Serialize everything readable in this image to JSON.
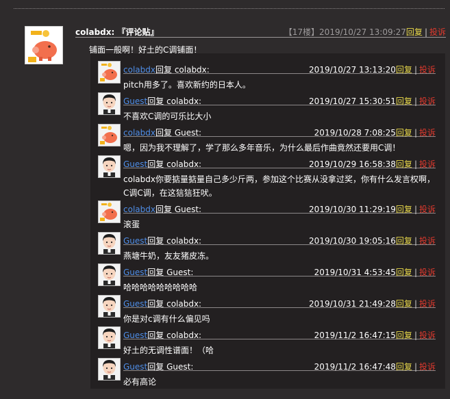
{
  "main": {
    "author": "colabdx:",
    "tag": "『评论贴』",
    "floor": "【17楼】",
    "time": "2019/10/27 13:09:27",
    "reply_label": "回复",
    "report_label": "投诉",
    "sep": "|",
    "text": "铺面一般啊！好土的C调铺面！"
  },
  "colors": {
    "background": "#2e2b2c",
    "replies_bg": "#232021",
    "user_link": "#4f8ee8",
    "reply": "#e8d94a",
    "report": "#e23a2e"
  },
  "replies": [
    {
      "user": "colabdx",
      "avatar": "piggy-bank",
      "reply_word": "回复",
      "target": "colabdx:",
      "time": "2019/10/27 13:13:20",
      "text": "pitch用多了。喜欢新约的日本人。"
    },
    {
      "user": "Guest",
      "avatar": "boy",
      "reply_word": "回复",
      "target": "colabdx:",
      "time": "2019/10/27 15:30:51",
      "text": "不喜欢C调的可乐比大小"
    },
    {
      "user": "colabdx",
      "avatar": "piggy-bank",
      "reply_word": "回复",
      "target": "Guest:",
      "time": "2019/10/28 7:08:25",
      "text": "嗯，因为我不理解了，学了那么多年音乐，为什么最后作曲竟然还要用C调！"
    },
    {
      "user": "Guest",
      "avatar": "boy",
      "reply_word": "回复",
      "target": "colabdx:",
      "time": "2019/10/29 16:58:38",
      "text": "colabdx你要掂量掂量自己多少斤两，参加这个比赛从没拿过奖，你有什么发言权啊，C调C调，在这狺狺狂吠。"
    },
    {
      "user": "colabdx",
      "avatar": "piggy-bank",
      "reply_word": "回复",
      "target": "Guest:",
      "time": "2019/10/30 11:29:19",
      "text": "滚蛋"
    },
    {
      "user": "Guest",
      "avatar": "boy",
      "reply_word": "回复",
      "target": "colabdx:",
      "time": "2019/10/30 19:05:16",
      "text": "燕塘牛奶，友友猪皮冻。"
    },
    {
      "user": "Guest",
      "avatar": "boy",
      "reply_word": "回复",
      "target": "Guest:",
      "time": "2019/10/31 4:53:45",
      "text": "哈哈哈哈哈哈哈哈哈"
    },
    {
      "user": "Guest",
      "avatar": "boy",
      "reply_word": "回复",
      "target": "colabdx:",
      "time": "2019/10/31 21:49:28",
      "text": "你是对c调有什么偏见吗"
    },
    {
      "user": "Guest",
      "avatar": "boy",
      "reply_word": "回复",
      "target": "colabdx:",
      "time": "2019/11/2 16:47:15",
      "text": "好土的无调性谱面！（哈"
    },
    {
      "user": "Guest",
      "avatar": "boy",
      "reply_word": "回复",
      "target": "Guest:",
      "time": "2019/11/2 16:47:48",
      "text": "必有高论"
    }
  ]
}
